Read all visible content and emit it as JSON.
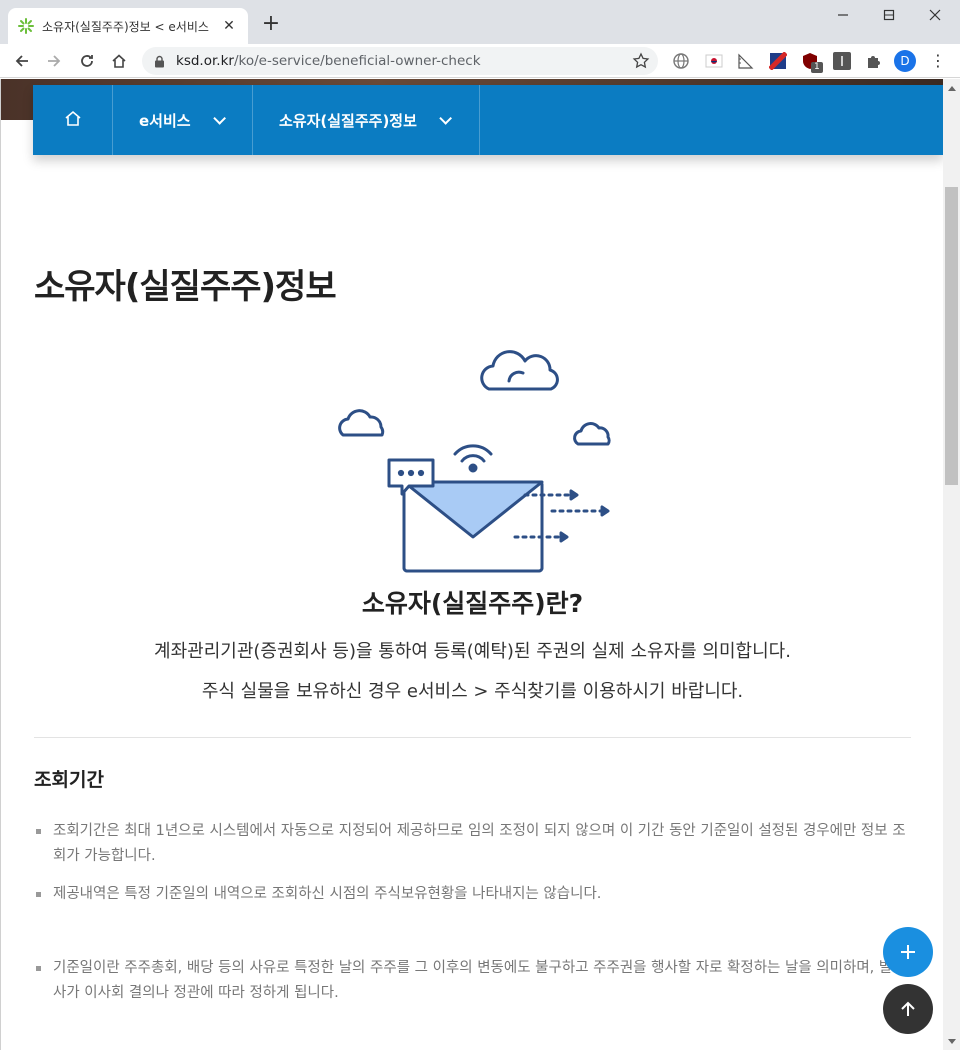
{
  "browser": {
    "tab_title": "소유자(실질주주)정보 < e서비스",
    "url_host": "ksd.or.kr",
    "url_path": "/ko/e-service/beneficial-owner-check",
    "avatar_letter": "D",
    "ext_badge": "1"
  },
  "gnb": {
    "menu1": "e서비스",
    "menu2": "소유자(실질주주)정보"
  },
  "page": {
    "title": "소유자(실질주주)정보",
    "subtitle": "소유자(실질주주)란?",
    "desc1": "계좌관리기관(증권회사 등)을 통하여 등록(예탁)된 주권의 실제 소유자를 의미합니다.",
    "desc2": "주식 실물을 보유하신 경우 e서비스 > 주식찾기를 이용하시기 바랍니다.",
    "section_heading": "조회기간",
    "notes": [
      "조회기간은 최대 1년으로 시스템에서 자동으로 지정되어 제공하므로 임의 조정이 되지 않으며 이 기간 동안 기준일이 설정된 경우에만 정보 조회가 가능합니다.",
      "제공내역은 특정 기준일의 내역으로 조회하신 시점의 주식보유현황을 나타내지는 않습니다.",
      "기준일이란 주주총회, 배당 등의 사유로 특정한 날의 주주를 그 이후의 변동에도 불구하고 주주권을 행사할 자로 확정하는 날을 의미하며, 발행사가 이사회 결의나 정관에 따라 정하게 됩니다."
    ]
  },
  "colors": {
    "gnb_bg": "#0b7cc2",
    "fab_plus": "#1a8fe0",
    "fab_top": "#333333",
    "illustration_stroke": "#2d4f86",
    "illustration_fill": "#a9cbf5"
  }
}
